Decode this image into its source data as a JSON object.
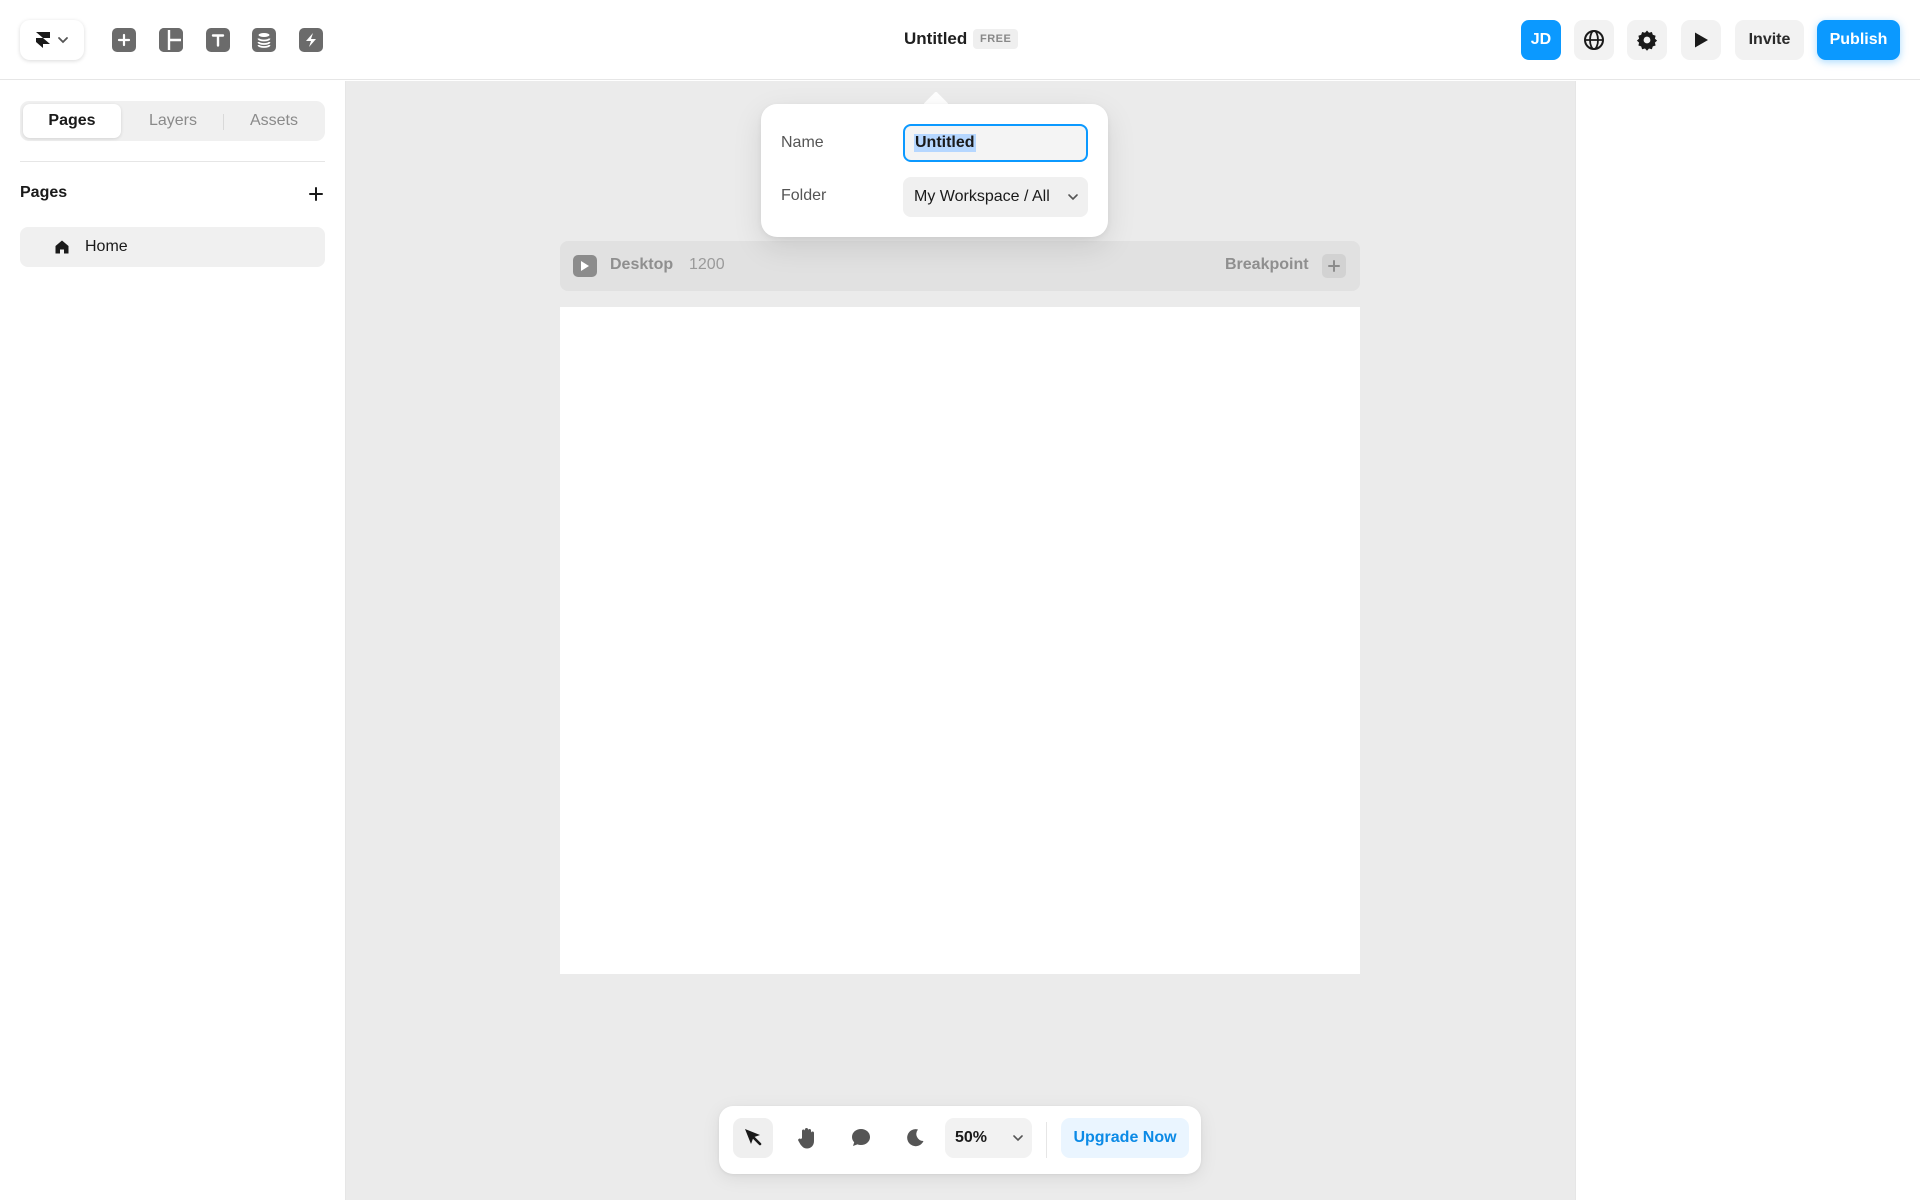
{
  "header": {
    "title": "Untitled",
    "plan_badge": "FREE",
    "avatar_initials": "JD",
    "invite_label": "Invite",
    "publish_label": "Publish"
  },
  "sidebar": {
    "tabs": [
      {
        "label": "Pages",
        "active": true
      },
      {
        "label": "Layers",
        "active": false
      },
      {
        "label": "Assets",
        "active": false
      }
    ],
    "section_title": "Pages",
    "pages": [
      {
        "label": "Home",
        "icon": "home-icon"
      }
    ]
  },
  "popover": {
    "name_label": "Name",
    "name_value": "Untitled",
    "folder_label": "Folder",
    "folder_value": "My Workspace / All"
  },
  "breakpoint": {
    "name": "Desktop",
    "width": "1200",
    "add_label": "Breakpoint"
  },
  "bottom_toolbar": {
    "zoom": "50%",
    "upgrade_label": "Upgrade Now"
  },
  "colors": {
    "accent": "#0b99ff",
    "canvas_bg": "#ebebeb"
  }
}
